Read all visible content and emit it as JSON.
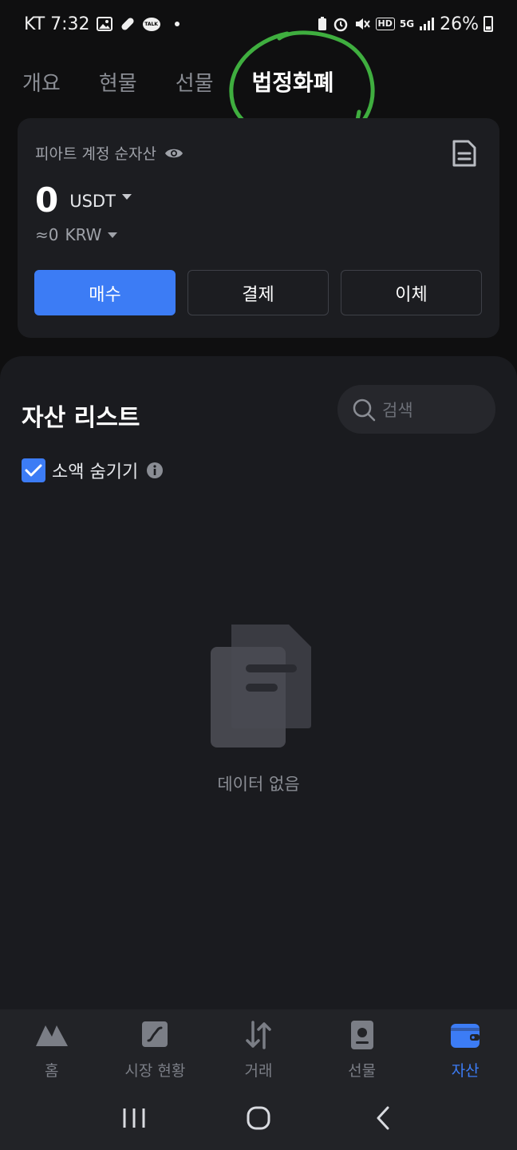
{
  "status_bar": {
    "carrier_time": "KT 7:32",
    "talk": "TALK",
    "hd": "HD",
    "network": "5G",
    "battery_pct": "26%"
  },
  "top_tabs": [
    {
      "label": "개요",
      "active": false
    },
    {
      "label": "현물",
      "active": false
    },
    {
      "label": "선물",
      "active": false
    },
    {
      "label": "법정화폐",
      "active": true
    }
  ],
  "fiat_card": {
    "title": "피아트 계정 순자산",
    "balance": "0",
    "balance_unit": "USDT",
    "krw_value": "≈0",
    "krw_unit": "KRW",
    "buttons": {
      "buy": "매수",
      "pay": "결제",
      "transfer": "이체"
    }
  },
  "asset_list": {
    "title": "자산 리스트",
    "search_placeholder": "검색",
    "hide_small_label": "소액 숨기기",
    "hide_small_checked": true,
    "empty_text": "데이터 없음"
  },
  "bottom_nav": [
    {
      "label": "홈",
      "icon": "home-icon",
      "active": false
    },
    {
      "label": "시장 현황",
      "icon": "market-icon",
      "active": false
    },
    {
      "label": "거래",
      "icon": "trade-icon",
      "active": false
    },
    {
      "label": "선물",
      "icon": "futures-icon",
      "active": false
    },
    {
      "label": "자산",
      "icon": "wallet-icon",
      "active": true
    }
  ],
  "colors": {
    "accent": "#3c7cf5",
    "annotation": "#3fae3f",
    "background": "#0f0f10",
    "card": "#1c1d21"
  }
}
